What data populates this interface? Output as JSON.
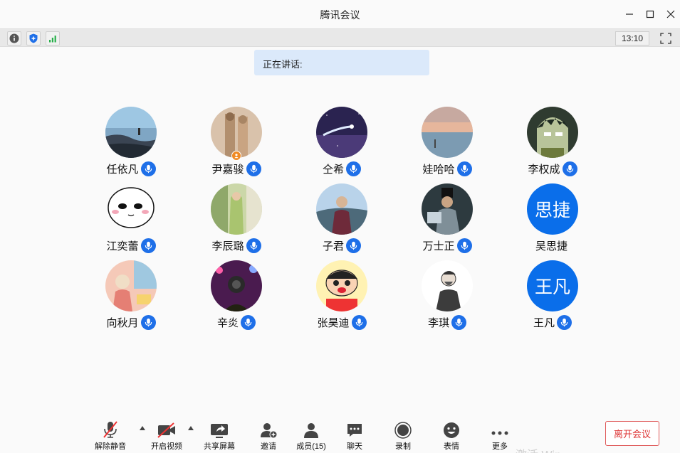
{
  "window": {
    "title": "腾讯会议"
  },
  "toolbar": {
    "clock": "13:10"
  },
  "speaking": {
    "label": "正在讲话:"
  },
  "members": [
    {
      "name": "任依凡",
      "avatar": "photo-seaside",
      "mic": true
    },
    {
      "name": "尹嘉骏",
      "avatar": "photo-figures",
      "mic": true,
      "host": true
    },
    {
      "name": "仝希",
      "avatar": "photo-comet",
      "mic": true
    },
    {
      "name": "娃哈哈",
      "avatar": "photo-sunset-sea",
      "mic": true
    },
    {
      "name": "李权成",
      "avatar": "cartoon-character",
      "mic": true
    },
    {
      "name": "江奕蕾",
      "avatar": "cartoon-white-face",
      "mic": true
    },
    {
      "name": "李辰璐",
      "avatar": "photo-girl-green",
      "mic": true
    },
    {
      "name": "子君",
      "avatar": "photo-man-lake",
      "mic": true
    },
    {
      "name": "万士正",
      "avatar": "photo-man-reading",
      "mic": true
    },
    {
      "name": "吴思捷",
      "avatar_text": "思捷",
      "mic": false
    },
    {
      "name": "向秋月",
      "avatar": "illustration-pink",
      "mic": true
    },
    {
      "name": "辛炎",
      "avatar": "photo-camera-lights",
      "mic": true
    },
    {
      "name": "张昊迪",
      "avatar": "cartoon-crayon",
      "mic": true
    },
    {
      "name": "李琪",
      "avatar": "sketch-man",
      "mic": true
    },
    {
      "name": "王凡",
      "avatar_text": "王凡",
      "mic": true,
      "mic_style": "plain"
    }
  ],
  "controls": {
    "unmute": "解除静音",
    "video": "开启视频",
    "share": "共享屏幕",
    "invite": "邀请",
    "members": "成员(15)",
    "chat": "聊天",
    "record": "录制",
    "emoji": "表情",
    "more": "更多"
  },
  "leave": {
    "label": "离开会议"
  },
  "watermark": {
    "text": "激活 Win..."
  },
  "colors": {
    "accent": "#1e6fe8",
    "leave": "#d33333",
    "speaking_bg": "#dbe9fa"
  }
}
